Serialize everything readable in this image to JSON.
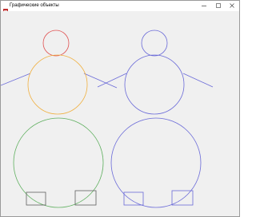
{
  "window": {
    "title": "Графические объекты",
    "icon": "app-form-icon",
    "controls": {
      "minimize": "minimize-icon",
      "maximize": "maximize-icon",
      "close": "close-icon"
    }
  },
  "colors": {
    "left_head": "#e05050",
    "left_body": "#f0b040",
    "left_base": "#60b060",
    "left_feet": "#606060",
    "left_arms": "#6a6ad8",
    "right_figure": "#6a6ad8"
  }
}
